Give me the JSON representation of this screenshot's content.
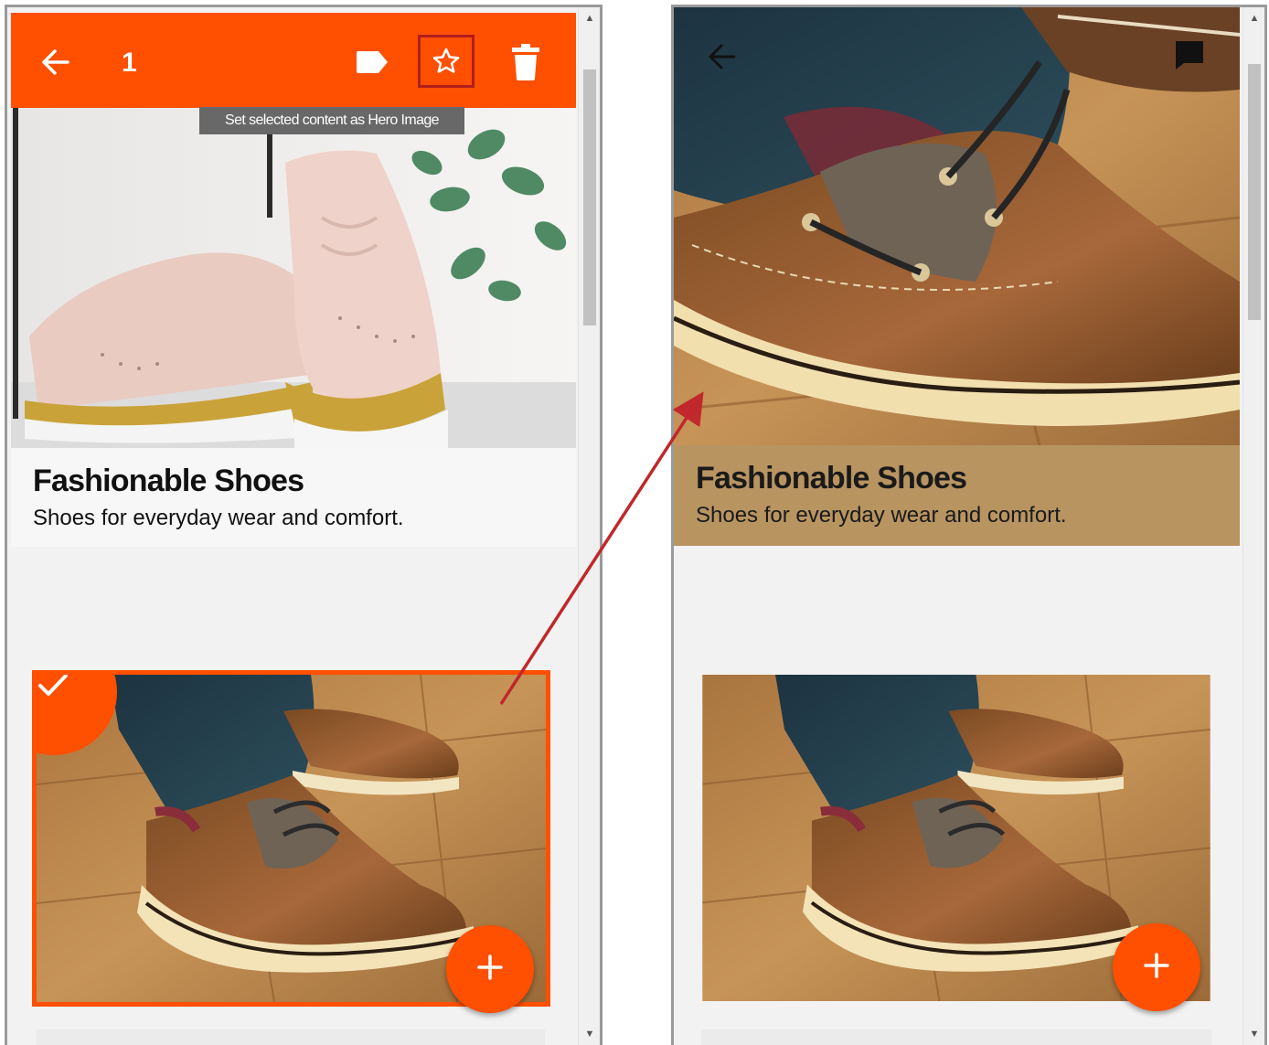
{
  "left_panel": {
    "toolbar": {
      "selected_count": "1",
      "back_icon": "arrow-left-icon",
      "tag_icon": "label-icon",
      "star_icon": "star-outline-icon",
      "delete_icon": "trash-icon",
      "color": "#ff4f00"
    },
    "tooltip": "Set selected content as Hero Image",
    "hero": {
      "title": "Fashionable Shoes",
      "description": "Shoes for everyday wear and comfort."
    },
    "selected_card": {
      "check_icon": "check-icon",
      "fab_icon": "plus-icon"
    }
  },
  "right_panel": {
    "header_icons": [
      "arrow-left-icon",
      "comment-icon"
    ],
    "hero": {
      "title": "Fashionable Shoes",
      "description": "Shoes for everyday wear and comfort.",
      "caption_color": "#b89461"
    },
    "card": {
      "fab_icon": "plus-icon"
    }
  },
  "colors": {
    "accent": "#ff4f00",
    "highlight_border": "#b01e1e",
    "annotation_arrow": "#c0282b"
  }
}
